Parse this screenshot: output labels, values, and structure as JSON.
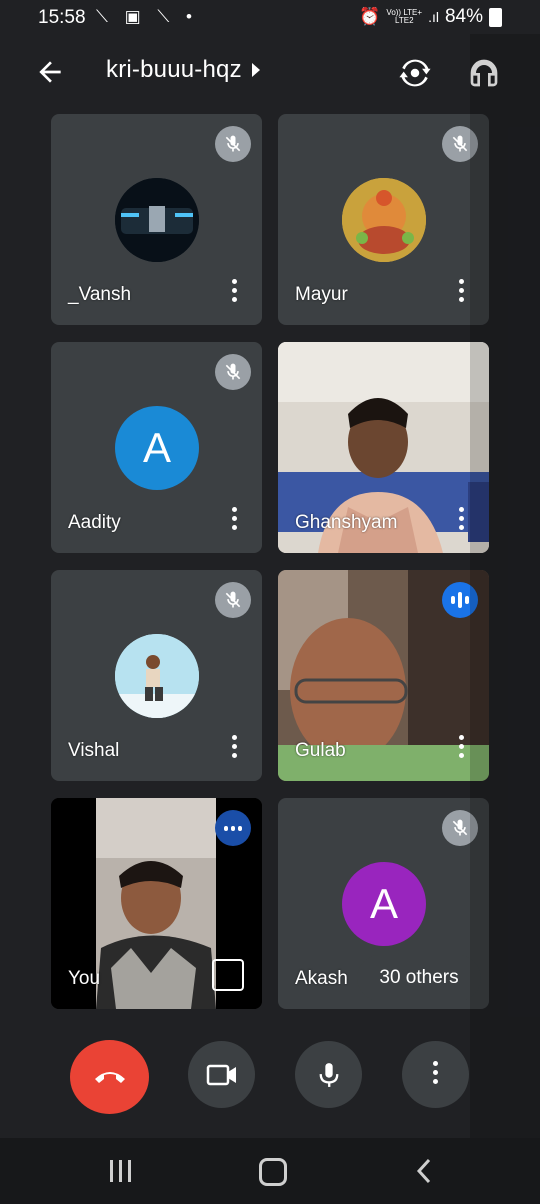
{
  "status_bar": {
    "time": "15:58",
    "network_top": "Vo)) LTE+",
    "network_bottom": "LTE2",
    "battery": "84%"
  },
  "header": {
    "meeting_code": "kri-buuu-hqz",
    "back_icon": "arrow-left-icon",
    "switch_camera_icon": "switch-camera-icon",
    "audio_output_icon": "headphones-icon"
  },
  "participants": [
    {
      "name": "_Vansh",
      "muted": true,
      "avatar": "car-photo"
    },
    {
      "name": "Mayur",
      "muted": true,
      "avatar": "deity-photo"
    },
    {
      "name": "Aadity",
      "muted": true,
      "avatar_letter": "A",
      "avatar_color": "#1a8ad6"
    },
    {
      "name": "Ghanshyam",
      "muted": false,
      "video": true
    },
    {
      "name": "Vishal",
      "muted": true,
      "avatar": "person-photo"
    },
    {
      "name": "Gulab",
      "muted": false,
      "speaking": true,
      "video": true
    },
    {
      "name": "You",
      "muted": false,
      "video": true
    },
    {
      "name": "Akash",
      "muted": true,
      "avatar_letter": "A",
      "avatar_color": "#9925be"
    }
  ],
  "others_label": "30 others",
  "colors": {
    "background": "#202124",
    "tile": "#3c4043",
    "end_call": "#ea4335",
    "speaking": "#1a73e8"
  }
}
